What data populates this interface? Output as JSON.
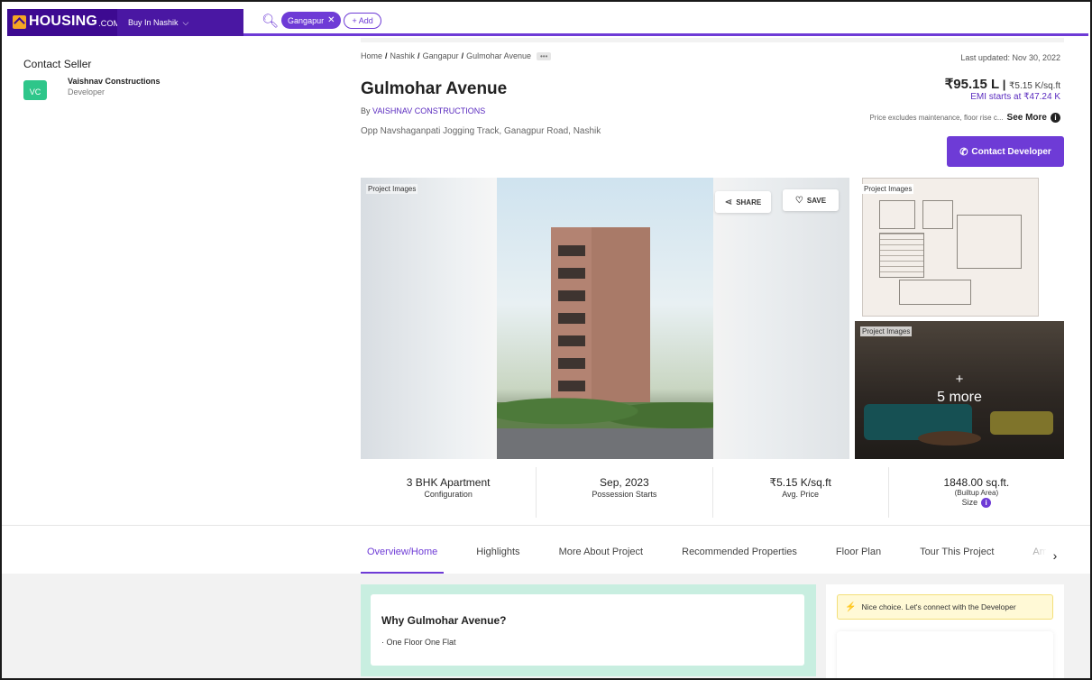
{
  "nav": {
    "logo_text": "HOUSING",
    "logo_suffix": ".COM",
    "buy_dropdown": "Buy In Nashik",
    "search_chip": "Gangapur",
    "add_chip": "+ Add"
  },
  "breadcrumb": [
    "Home",
    "Nashik",
    "Gangapur",
    "Gulmohar Avenue"
  ],
  "breadcrumb_more": "•••",
  "last_updated": "Last updated: Nov 30, 2022",
  "project": {
    "title": "Gulmohar Avenue",
    "by_prefix": "By ",
    "developer": "VAISHNAV CONSTRUCTIONS",
    "address": "Opp Navshaganpati Jogging Track, Ganagpur Road, Nashik"
  },
  "pricing": {
    "price": "₹95.15 L",
    "divider": " | ",
    "per_sqft": "₹5.15 K/sq.ft",
    "emi": "EMI starts at ₹47.24 K",
    "exclusion": "Price excludes maintenance, floor rise c...",
    "see_more": "See More",
    "info": "i"
  },
  "contact_button": "Contact Developer",
  "gallery": {
    "main_label": "Project Images",
    "side1_label": "Project Images",
    "side2_label": "Project Images",
    "share": "SHARE",
    "save": "SAVE",
    "more_plus": "+",
    "more_text": "5 more"
  },
  "stats": [
    {
      "value": "3 BHK Apartment",
      "label": "Configuration"
    },
    {
      "value": "Sep, 2023",
      "label": "Possession Starts"
    },
    {
      "value": "₹5.15 K/sq.ft",
      "label": "Avg. Price"
    },
    {
      "value": "1848.00 sq.ft.",
      "label": "(Builtup Area)",
      "label2": "Size"
    }
  ],
  "tabs": [
    "Overview/Home",
    "Highlights",
    "More About Project",
    "Recommended Properties",
    "Floor Plan",
    "Tour This Project",
    "Amenities"
  ],
  "why": {
    "title": "Why Gulmohar Avenue?",
    "items": [
      "One Floor One Flat"
    ]
  },
  "seller": {
    "banner": "Nice choice. Let's connect with the Developer",
    "heading": "Contact Seller",
    "avatar": "VC",
    "name": "Vaishnav Constructions",
    "role": "Developer"
  },
  "colors": {
    "brand": "#3d0a91",
    "accent": "#6e3bd6",
    "why_bg": "#c8eee0",
    "avatar": "#2ec68a"
  },
  "icons": [
    "search-icon",
    "close-icon",
    "chevron-down-icon",
    "share-icon",
    "heart-icon",
    "phone-icon",
    "info-icon",
    "bolt-icon",
    "chevron-right-icon"
  ]
}
